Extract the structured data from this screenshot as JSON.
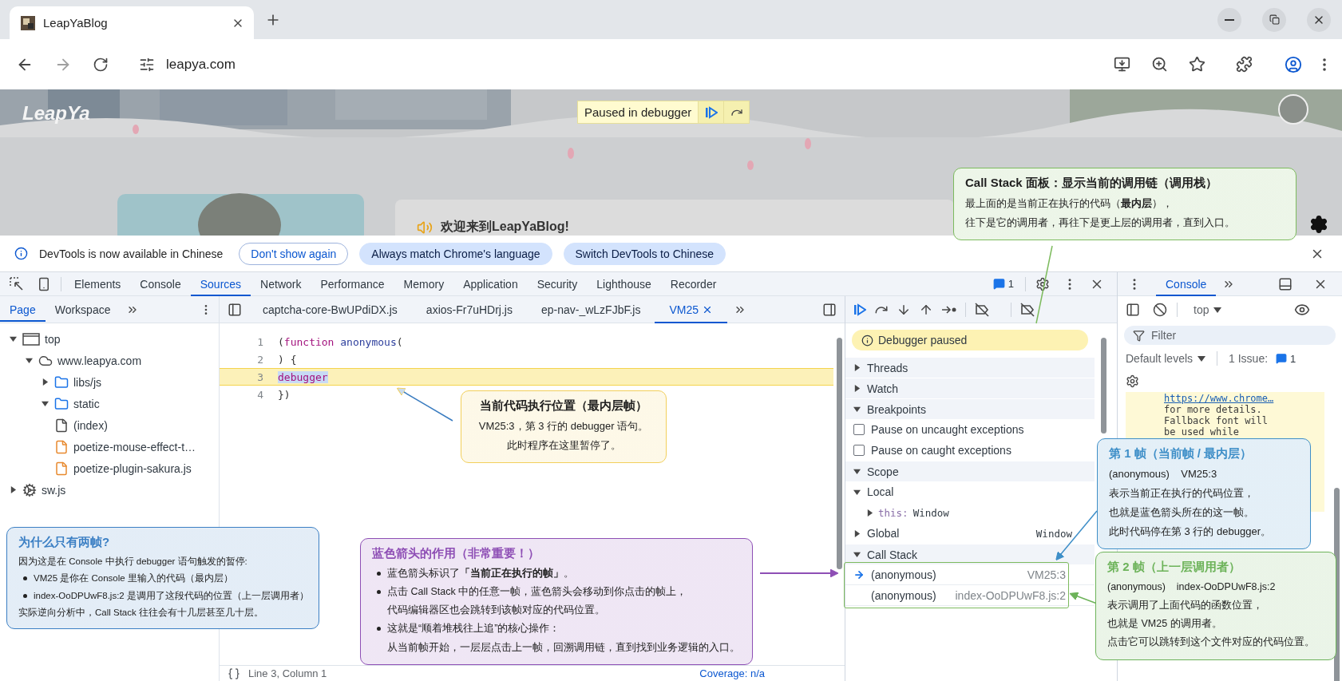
{
  "browser": {
    "tab_title": "LeapYaBlog",
    "address": "leapya.com"
  },
  "webpage": {
    "logo": "LeapYa",
    "paused_label": "Paused in debugger",
    "welcome": "欢迎来到LeapYaBlog!"
  },
  "infobar": {
    "message": "DevTools is now available in Chinese",
    "buttons": [
      {
        "label": "Don't show again",
        "kind": "outline"
      },
      {
        "label": "Always match Chrome's language",
        "kind": "filled"
      },
      {
        "label": "Switch DevTools to Chinese",
        "kind": "filled"
      }
    ]
  },
  "devtools": {
    "tabs": [
      {
        "label": "Elements",
        "selected": false
      },
      {
        "label": "Console",
        "selected": false
      },
      {
        "label": "Sources",
        "selected": true
      },
      {
        "label": "Network",
        "selected": false
      },
      {
        "label": "Performance",
        "selected": false
      },
      {
        "label": "Memory",
        "selected": false
      },
      {
        "label": "Application",
        "selected": false
      },
      {
        "label": "Security",
        "selected": false
      },
      {
        "label": "Lighthouse",
        "selected": false
      },
      {
        "label": "Recorder",
        "selected": false
      }
    ],
    "issues_count": "1",
    "navigator": {
      "tabs": [
        {
          "label": "Page",
          "selected": true
        },
        {
          "label": "Workspace",
          "selected": false
        }
      ],
      "tree": [
        {
          "label": "top",
          "kind": "frame",
          "expanded": true,
          "children": [
            {
              "label": "www.leapya.com",
              "kind": "domain",
              "expanded": true,
              "children": [
                {
                  "label": "libs/js",
                  "kind": "folder",
                  "expanded": false
                },
                {
                  "label": "static",
                  "kind": "folder",
                  "expanded": true
                },
                {
                  "label": "(index)",
                  "kind": "document"
                },
                {
                  "label": "poetize-mouse-effect-t…",
                  "kind": "script"
                },
                {
                  "label": "poetize-plugin-sakura.js",
                  "kind": "script"
                }
              ]
            }
          ]
        },
        {
          "label": "sw.js",
          "kind": "worker",
          "expanded": false
        }
      ]
    },
    "editor": {
      "files": [
        {
          "label": "captcha-core-BwUPdiDX.js",
          "selected": false,
          "closable": false
        },
        {
          "label": "axios-Fr7uHDrj.js",
          "selected": false,
          "closable": false
        },
        {
          "label": "ep-nav-_wLzFJbF.js",
          "selected": false,
          "closable": false
        },
        {
          "label": "VM25",
          "selected": true,
          "closable": true
        }
      ],
      "lines": [
        {
          "number": "1",
          "current": false,
          "tokens": [
            {
              "text": "(",
              "kind": "punct"
            },
            {
              "text": "function",
              "kind": "keyword"
            },
            {
              "text": "anonymous",
              "kind": "name"
            },
            {
              "text": "(",
              "kind": "punct"
            }
          ]
        },
        {
          "number": "2",
          "current": false,
          "tokens": [
            {
              "text": ") {",
              "kind": "punct"
            }
          ]
        },
        {
          "number": "3",
          "current": true,
          "tokens": [
            {
              "text": "debugger",
              "kind": "keyword"
            }
          ]
        },
        {
          "number": "4",
          "current": false,
          "tokens": [
            {
              "text": "})",
              "kind": "punct"
            }
          ]
        }
      ],
      "position": "Line 3, Column 1",
      "coverage": "Coverage: n/a"
    },
    "debugger": {
      "banner": "Debugger paused",
      "sections": [
        {
          "kind": "plain",
          "title": "Threads",
          "expanded": false
        },
        {
          "kind": "plain",
          "title": "Watch",
          "expanded": false
        },
        {
          "kind": "breakpoints",
          "title": "Breakpoints",
          "expanded": true,
          "options": [
            {
              "label": "Pause on uncaught exceptions",
              "checked": false
            },
            {
              "label": "Pause on caught exceptions",
              "checked": false
            }
          ]
        },
        {
          "kind": "scope",
          "title": "Scope",
          "expanded": true,
          "scopes": [
            {
              "title": "Local",
              "expanded": true,
              "entries": [
                {
                  "key": "this:",
                  "value": "Window"
                }
              ]
            },
            {
              "title": "Global",
              "expanded": false,
              "value": "Window"
            }
          ]
        },
        {
          "kind": "callstack",
          "title": "Call Stack",
          "expanded": true,
          "frames": [
            {
              "name": "(anonymous)",
              "location": "VM25:3",
              "selected": true
            },
            {
              "name": "(anonymous)",
              "location": "index-OoDPUwF8.js:2",
              "selected": false
            }
          ]
        }
      ]
    },
    "console": {
      "tab": "Console",
      "context": "top",
      "filter_placeholder": "Filter",
      "levels": "Default levels",
      "issues_label": "1 Issue:",
      "issues_count": "1",
      "messages": [
        {
          "text": "https://www.chrome…",
          "kind": "link"
        },
        {
          "text": "for more details.",
          "kind": "text"
        },
        {
          "text": "Fallback font will",
          "kind": "text"
        },
        {
          "text": "be used while",
          "kind": "text"
        }
      ]
    }
  },
  "annotations": [
    {
      "kind": "plain",
      "color": "#7dbb5e",
      "title": "Call Stack 面板：显示当前的调用链（调用栈）",
      "lines": [
        {
          "kind": "text",
          "text": "最上面的是当前正在执行的代码（**最内层**），"
        },
        {
          "kind": "text",
          "text": "往下是它的调用者，再往下是更上层的调用者，直到入口。"
        }
      ]
    },
    {
      "kind": "centered",
      "color": "#f2cf5b",
      "title": "当前代码执行位置（最内层帧）",
      "lines": [
        {
          "kind": "text",
          "text": "VM25:3，第 3 行的 debugger 语句。"
        },
        {
          "kind": "text",
          "text": "此时程序在这里暂停了。"
        }
      ]
    },
    {
      "kind": "tinted",
      "color": "#3b7fc4",
      "title": "为什么只有两帧?",
      "lines": [
        {
          "kind": "text",
          "text": "因为这是在 Console 中执行 debugger 语句触发的暂停:"
        },
        {
          "kind": "bullet",
          "text": "VM25 是你在 Console 里输入的代码（最内层）"
        },
        {
          "kind": "bullet",
          "text": "index-OoDPUwF8.js:2 是调用了这段代码的位置（上一层调用者）"
        },
        {
          "kind": "text",
          "text": "实际逆向分析中，Call Stack 往往会有十几层甚至几十层。"
        }
      ]
    },
    {
      "kind": "tinted",
      "color": "#8e4fb5",
      "title": "蓝色箭头的作用（非常重要！）",
      "lines": [
        {
          "kind": "bullet",
          "text": "蓝色箭头标识了**「当前正在执行的帧」**。"
        },
        {
          "kind": "bullet",
          "text": "点击 Call Stack 中的任意一帧，蓝色箭头会移动到你点击的帧上，"
        },
        {
          "kind": "indent",
          "text": "代码编辑器区也会跳转到该帧对应的代码位置。"
        },
        {
          "kind": "bullet",
          "text": "这就是“顺着堆栈往上追”的核心操作："
        },
        {
          "kind": "indent",
          "text": "从当前帧开始，一层层点击上一帧，回溯调用链，直到找到业务逻辑的入口。"
        }
      ]
    },
    {
      "kind": "tinted",
      "color": "#3f8fc8",
      "title": "第 1 帧（当前帧 / 最内层）",
      "lines": [
        {
          "kind": "text",
          "text": "(anonymous)    VM25:3"
        },
        {
          "kind": "text",
          "text": "表示当前正在执行的代码位置，"
        },
        {
          "kind": "text",
          "text": "也就是蓝色箭头所在的这一帧。"
        },
        {
          "kind": "text",
          "text": "此时代码停在第 3 行的 debugger。"
        }
      ]
    },
    {
      "kind": "tinted",
      "color": "#6db35a",
      "title": "第 2 帧（上一层调用者）",
      "lines": [
        {
          "kind": "text",
          "text": "(anonymous)    index-OoDPUwF8.js:2"
        },
        {
          "kind": "text",
          "text": "表示调用了上面代码的函数位置，"
        },
        {
          "kind": "text",
          "text": "也就是 VM25 的调用者。"
        },
        {
          "kind": "text",
          "text": "点击它可以跳转到这个文件对应的代码位置。"
        }
      ]
    }
  ]
}
